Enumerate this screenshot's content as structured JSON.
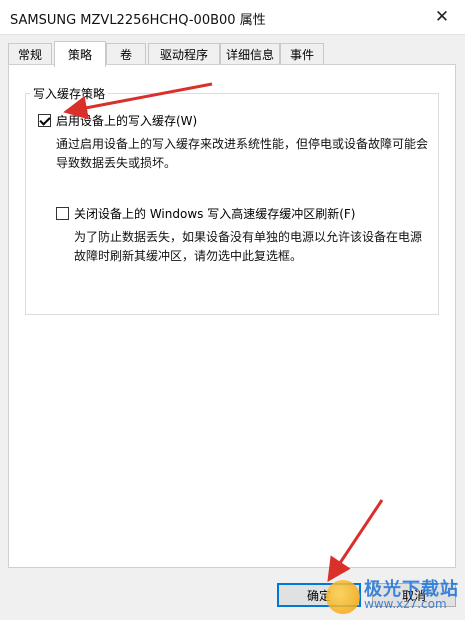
{
  "window": {
    "title": "SAMSUNG MZVL2256HCHQ-00B00 属性",
    "close_symbol": "✕"
  },
  "tabs": [
    {
      "label": "常规",
      "active": false
    },
    {
      "label": "策略",
      "active": true
    },
    {
      "label": "卷",
      "active": false
    },
    {
      "label": "驱动程序",
      "active": false
    },
    {
      "label": "详细信息",
      "active": false
    },
    {
      "label": "事件",
      "active": false
    }
  ],
  "write_cache_policy": {
    "group_title": "写入缓存策略",
    "enable_cache": {
      "label": "启用设备上的写入缓存(W)",
      "checked": true,
      "description_lines": [
        "通过启用设备上的写入缓存来改进系统性能，但停电或设备故障可能会",
        "导致数据丢失或损坏。"
      ]
    },
    "disable_flush": {
      "label": "关闭设备上的 Windows 写入高速缓存缓冲区刷新(F)",
      "checked": false,
      "description_lines": [
        "为了防止数据丢失，如果设备没有单独的电源以允许该设备在电源",
        "故障时刷新其缓冲区，请勿选中此复选框。"
      ]
    }
  },
  "buttons": {
    "ok": "确定",
    "cancel": "取消"
  },
  "watermark": {
    "name": "极光下载站",
    "url": "www.xz7.com"
  },
  "colors": {
    "annotation_arrow": "#d9302c",
    "default_button_border": "#0078d7"
  }
}
